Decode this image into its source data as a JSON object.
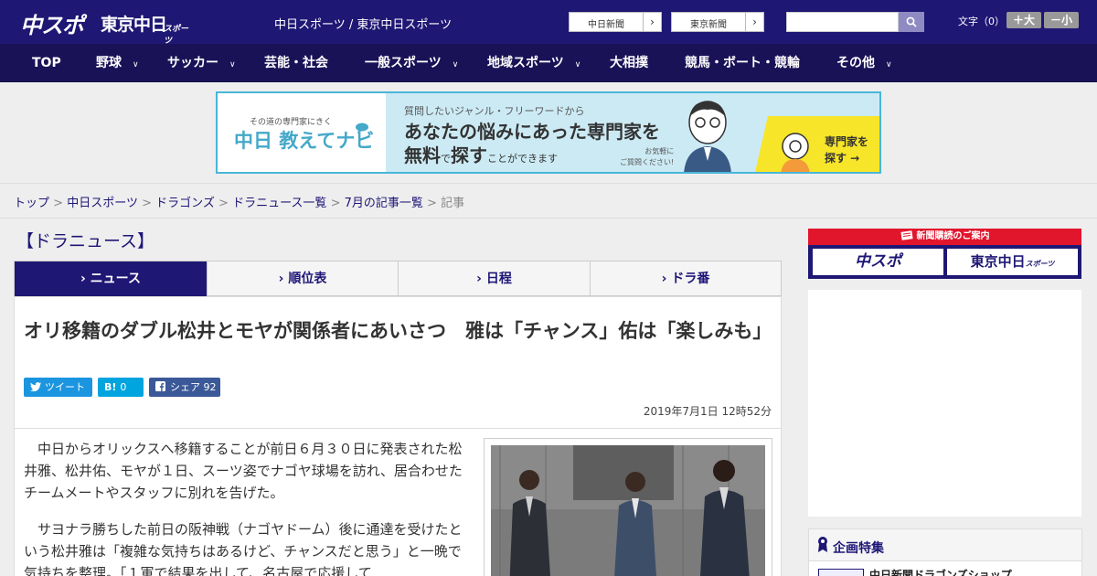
{
  "header": {
    "logo_chusupo": "中スポ",
    "logo_tokyo": "東京中日",
    "logo_sports": "スポーツ",
    "site_links": "中日スポーツ / 東京中日スポーツ",
    "paper_links": [
      "中日新聞",
      "東京新聞"
    ],
    "search_placeholder": "",
    "text_size_label": "文字（0）",
    "size_up": "＋大",
    "size_down": "－小"
  },
  "nav": {
    "items": [
      {
        "label": "TOP",
        "dropdown": false
      },
      {
        "label": "野球",
        "dropdown": true
      },
      {
        "label": "サッカー",
        "dropdown": true
      },
      {
        "label": "芸能・社会",
        "dropdown": false
      },
      {
        "label": "一般スポーツ",
        "dropdown": true
      },
      {
        "label": "地域スポーツ",
        "dropdown": true
      },
      {
        "label": "大相撲",
        "dropdown": false
      },
      {
        "label": "競馬・ボート・競輪",
        "dropdown": false
      },
      {
        "label": "その他",
        "dropdown": true
      }
    ],
    "chevron": "∨"
  },
  "banner": {
    "sub": "その道の専門家にきく",
    "title": "中日 教えてナビ",
    "question": "質問したいジャンル・フリーワードから",
    "headline1": "あなたの悩みにあった専門家を",
    "headline2a": "無料",
    "headline2b": "で",
    "headline2c": "探す",
    "headline2d": "ことができます",
    "note1": "お気軽に",
    "note2": "ご質問ください!",
    "cta1": "専門家を",
    "cta2": "探す →",
    "colors": {
      "border": "#49b6d8",
      "bg": "#cceaf4",
      "cta": "#f7e529"
    }
  },
  "breadcrumb": {
    "items": [
      "トップ",
      "中日スポーツ",
      "ドラゴンズ",
      "ドラニュース一覧",
      "7月の記事一覧"
    ],
    "current": "記事",
    "sep": ">"
  },
  "section_title": "【ドラニュース】",
  "tabs": {
    "items": [
      "ニュース",
      "順位表",
      "日程",
      "ドラ番"
    ],
    "active_index": 0,
    "marker": "›"
  },
  "article": {
    "headline": "オリ移籍のダブル松井とモヤが関係者にあいさつ　雅は「チャンス」佑は「楽しみも」",
    "share": {
      "tweet": "ツイート",
      "hatena": "0",
      "hatena_icon": "B!",
      "fb": "シェア",
      "fb_count": "92"
    },
    "date": "2019年7月1日 12時52分",
    "paragraphs": [
      "中日からオリックスへ移籍することが前日６月３０日に発表された松井雅、松井佑、モヤが１日、スーツ姿でナゴヤ球場を訪れ、居合わせたチームメートやスタッフに別れを告げた。",
      "サヨナラ勝ちした前日の阪神戦（ナゴヤドーム）後に通達を受けたという松井雅は「複雑な気持ちはあるけど、チャンスだと思う」と一晩で気持ちを整理。「１軍で結果を出して、名古屋で応援して"
    ]
  },
  "sidebar": {
    "subscribe_label": "新聞購読のご案内",
    "logo_chusupo": "中スポ",
    "logo_tokyo": "東京中日",
    "logo_sports": "スポーツ",
    "feature_title": "企画特集",
    "feature_item": "中日新聞ドラゴンズショップ"
  },
  "colors": {
    "brand": "#1f1774",
    "nav": "#1a1257",
    "accent_red": "#e1162d"
  }
}
